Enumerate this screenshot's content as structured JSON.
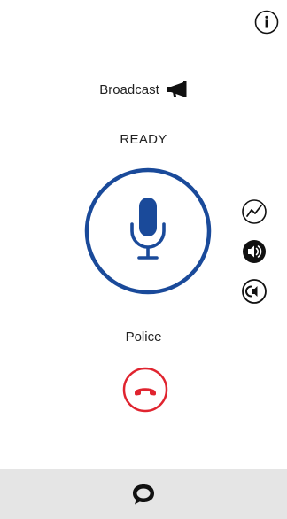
{
  "header": {
    "info_icon": "info-icon"
  },
  "broadcast": {
    "label": "Broadcast",
    "icon": "megaphone-icon"
  },
  "status": {
    "text": "READY"
  },
  "ptt": {
    "icon": "microphone-icon",
    "ring_color": "#1a4a9a"
  },
  "side_controls": [
    {
      "icon": "signal-quality-icon"
    },
    {
      "icon": "speaker-icon"
    },
    {
      "icon": "earpiece-icon"
    }
  ],
  "channel": {
    "name": "Police"
  },
  "hangup": {
    "icon": "end-call-icon",
    "color": "#e0242f"
  },
  "bottom_bar": {
    "icon": "chat-icon",
    "background": "#e5e5e5"
  }
}
